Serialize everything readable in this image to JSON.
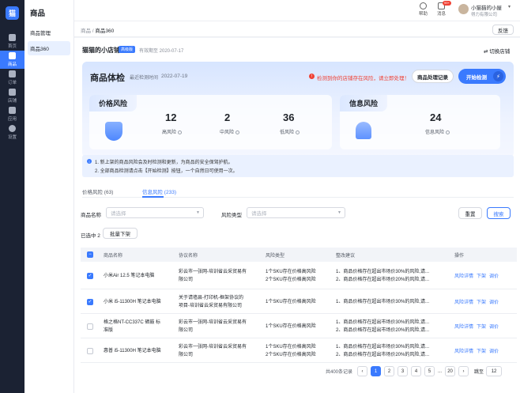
{
  "nav": {
    "logo": "猫",
    "items": [
      {
        "label": "首页",
        "icon": "home-icon"
      },
      {
        "label": "商品",
        "icon": "goods-icon"
      },
      {
        "label": "订单",
        "icon": "order-icon"
      },
      {
        "label": "店铺",
        "icon": "store-icon"
      },
      {
        "label": "应用",
        "icon": "apps-icon"
      },
      {
        "label": "设置",
        "icon": "settings-icon"
      }
    ]
  },
  "subnav": {
    "title": "商品",
    "items": [
      "商品管理",
      "商品360"
    ]
  },
  "topbar": {
    "help": "帮助",
    "message": "消息",
    "message_badge": "99+",
    "user_name": "小猫猫的小屋",
    "company": "得力有限公司"
  },
  "breadcrumb": {
    "parent": "商品",
    "sep": " / ",
    "current": "商品360"
  },
  "feedback": "反馈",
  "shop": {
    "name": "猫猫的小店铺",
    "tag": "高级版",
    "expire": "有效期至 2020-07-17",
    "switch": "切换店铺"
  },
  "check": {
    "title": "商品体检",
    "time_label": "最近检测时间",
    "time": "2022-07-19",
    "warning": "检测到你的店铺存在风险，请立即处理！",
    "records_button": "商品处理记录",
    "start_button": "开始检测"
  },
  "price_risk": {
    "title": "价格风险",
    "stats": [
      {
        "value": "12",
        "label": "高风险"
      },
      {
        "value": "2",
        "label": "中风险"
      },
      {
        "value": "36",
        "label": "低风险"
      }
    ]
  },
  "info_risk": {
    "title": "信息风险",
    "stats": [
      {
        "value": "24",
        "label": "信息风险"
      }
    ]
  },
  "notice": {
    "lines": [
      "1. 新上架的商品风险会及时检测和更新，为商品的安全保驾护航。",
      "2. 全部商品检测请点击【开始检测】按钮，一个自然日可使用一次。"
    ]
  },
  "tabs": [
    "价格风险 (63)",
    "信息风险 (233)"
  ],
  "filters": {
    "name_label": "商品名称",
    "name_placeholder": "请选择",
    "type_label": "风险类型",
    "type_placeholder": "请选择",
    "reset": "重置",
    "search": "搜索"
  },
  "selection": {
    "text": "已选中 2",
    "bulk": "批量下架"
  },
  "table": {
    "headers": [
      "商品名称",
      "协议名称",
      "风险类型",
      "整改建议",
      "操作"
    ],
    "rows": [
      {
        "checked": true,
        "name": [
          "小米Air 12.5 笔记本电脑"
        ],
        "protocol": [
          "彩云市一张网-培训省云采贸易有",
          "限公司"
        ],
        "risk": [
          "1个SKU存在价格高风险",
          "2个SKU存在价格高风险"
        ],
        "advice": [
          "1、商品价格存在超出市场价30%的风险,请...",
          "2、商品价格存在超出市场价20%的风险,请..."
        ]
      },
      {
        "checked": true,
        "name": [
          "小米 i5-11300H 笔记本电脑"
        ],
        "protocol": [
          "关于请墙县-打印机-框架协议的",
          "项目-培训省云采贸易有限公司"
        ],
        "risk": [
          "1个SKU存在价格高风险"
        ],
        "advice": [
          "1、商品价格存在超出市场价30%的风险,请..."
        ]
      },
      {
        "checked": false,
        "name": [
          "格之格NT-CC337C 硒鼓 标",
          "准版"
        ],
        "protocol": [
          "彩云市一张网-培训省云采贸易有",
          "限公司"
        ],
        "risk": [
          "1个SKU存在价格高风险"
        ],
        "advice": [
          "1、商品价格存在超出市场价30%的风险,请...",
          "2、商品价格存在超出市场价20%的风险,请..."
        ]
      },
      {
        "checked": false,
        "name": [
          "惠普 i5-11300H 笔记本电脑"
        ],
        "protocol": [
          "彩云市一张网-培训省云采贸易有",
          "限公司"
        ],
        "risk": [
          "1个SKU存在价格高风险",
          "2个SKU存在价格高风险"
        ],
        "advice": [
          "1、商品价格存在超出市场价30%的风险,请...",
          "2、商品价格存在超出市场价20%的风险,请..."
        ]
      }
    ],
    "ops": [
      "风险详情",
      "下架",
      "调价"
    ]
  },
  "pager": {
    "total": "共400条记录",
    "prev": "‹",
    "pages": [
      "1",
      "2",
      "3",
      "4",
      "5",
      "...",
      "20"
    ],
    "current": "1",
    "next": "›",
    "goto_label": "跳至",
    "goto_value": "12"
  }
}
